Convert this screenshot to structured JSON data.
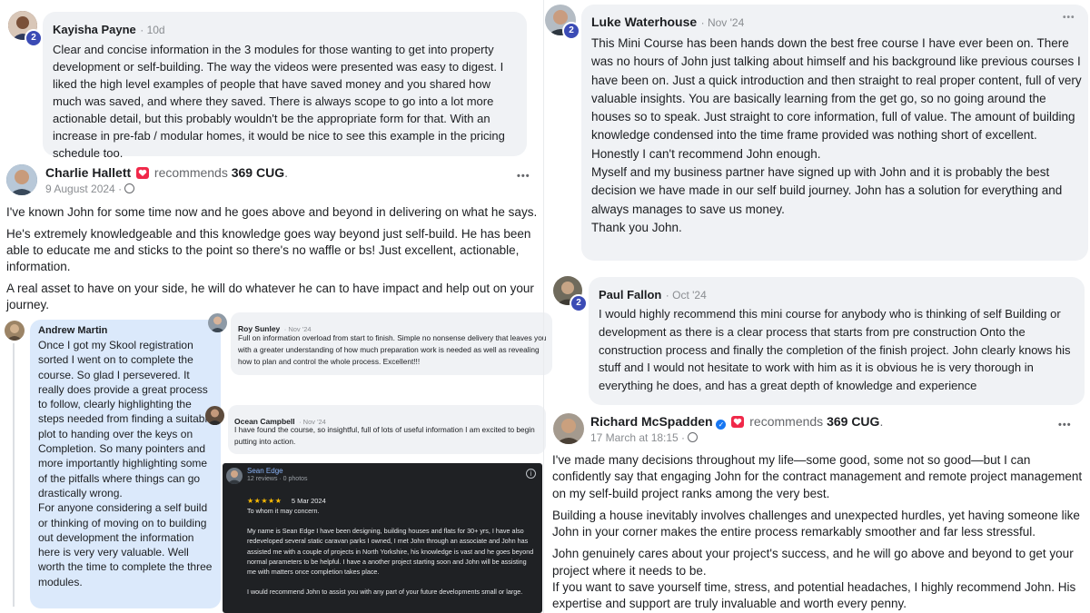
{
  "kayisha": {
    "name": "Kayisha Payne",
    "time": "10d",
    "badge": "2",
    "text": "Clear and concise information in the 3 modules for those wanting to get into property development or self-building. The way the videos were presented was easy to digest. I liked the high level examples of people that have saved money and you shared how much was saved, and where they saved. There is always scope to go into a lot more actionable detail, but this probably wouldn't be the appropriate form for that. With an increase in pre-fab / modular homes, it would be nice to see this example in the pricing schedule too."
  },
  "charlie": {
    "name": "Charlie Hallett",
    "recommends": "recommends",
    "page": "369 CUG",
    "date": "9 August 2024 ·",
    "paragraphs": [
      "I've known John for some time now and he goes above and beyond in delivering on what he says.",
      "He's extremely knowledgeable and this knowledge goes way beyond just self-build. He has been able to educate me and sticks to the point so there's no waffle or bs! Just excellent, actionable, information.",
      "A real asset to have on your side, he will do whatever he can to have impact and help out on your journey."
    ]
  },
  "andrew": {
    "name": "Andrew Martin",
    "text1": "Once I got my Skool registration sorted I went on to complete the course. So glad I persevered. It really does provide a great process to follow, clearly highlighting the steps needed from finding a suitable plot to handing over the keys on Completion. So many pointers and more importantly highlighting some of the pitfalls where things can go drastically wrong.",
    "text2": "For anyone considering a self build or thinking of moving on to building out development the information here is very very valuable. Well worth the time to complete the three modules."
  },
  "roy": {
    "name": "Roy Sunley",
    "time": "Nov '24",
    "text": "Full on information overload from start to finish. Simple no nonsense delivery that leaves you with a greater understanding of how much preparation work is needed as well as revealing how to plan and control the whole process. Excellent!!!"
  },
  "ocean": {
    "name": "Ocean Campbell",
    "time": "Nov '24",
    "text": "I have found the course, so insightful, full of lots of useful information I am excited to begin putting into action."
  },
  "sean": {
    "name": "Sean Edge",
    "stats": "12 reviews · 0 photos",
    "stars": "★★★★★",
    "date": "5 Mar 2024",
    "p1": "To whom it may concern.",
    "p2": "My name is Sean Edge I have been designing, building houses and flats for 30+ yrs, I have also redeveloped several static caravan parks I owned, I met John through an associate and John has assisted me with a couple of projects in North Yorkshire, his knowledge is vast and he goes beyond normal parameters to be helpful. I have a another project starting soon and John will be assisting me with matters once completion takes place.",
    "p3": "I would recommend John to assist you with any part of your future developments small or large."
  },
  "luke": {
    "name": "Luke Waterhouse",
    "time": "Nov '24",
    "badge": "2",
    "lines": [
      "This Mini Course has been hands down the best free course I have ever been on. There was no hours of John just talking about himself and his background like previous courses I have been on. Just a quick introduction and then straight to real proper content, full of very valuable insights. You are basically learning from the get go, so no going around the houses so to speak. Just straight to core information, full of value. The amount of building knowledge condensed into the time frame provided was nothing short of excellent.",
      "Honestly I can't recommend John enough.",
      "Myself and my business partner have signed up with John and it is probably the best decision we have made in our self build journey. John has a solution for everything and always manages to save us money.",
      "Thank you John."
    ]
  },
  "paul": {
    "name": "Paul Fallon",
    "time": "Oct '24",
    "badge": "2",
    "text": "I would highly recommend this mini course for anybody who is thinking of self Building or development as there is a clear process that starts from pre construction Onto the construction process and finally the completion of the finish project. John clearly knows his stuff and I would not hesitate to work with him as it is obvious he is very thorough in everything he does, and has a great depth of knowledge and experience"
  },
  "richard": {
    "name": "Richard McSpadden",
    "recommends": "recommends",
    "page": "369 CUG",
    "date": "17 March at 18:15 ·",
    "paragraphs": [
      "I've made many decisions throughout my life—some good, some not so good—but I can confidently say that engaging John for the contract management and remote project management on my self-build project ranks among the very best.",
      "Building a house inevitably involves challenges and unexpected hurdles, yet having someone like John in your corner makes the entire process remarkably smoother and far less stressful.",
      "John genuinely cares about your project's success, and he will go above and beyond to get your project where it needs to be.",
      "If you want to save yourself time, stress, and potential headaches, I highly recommend John. His expertise and support are truly invaluable and worth every penny."
    ]
  },
  "ui": {
    "dots": "•••",
    "period": "."
  }
}
